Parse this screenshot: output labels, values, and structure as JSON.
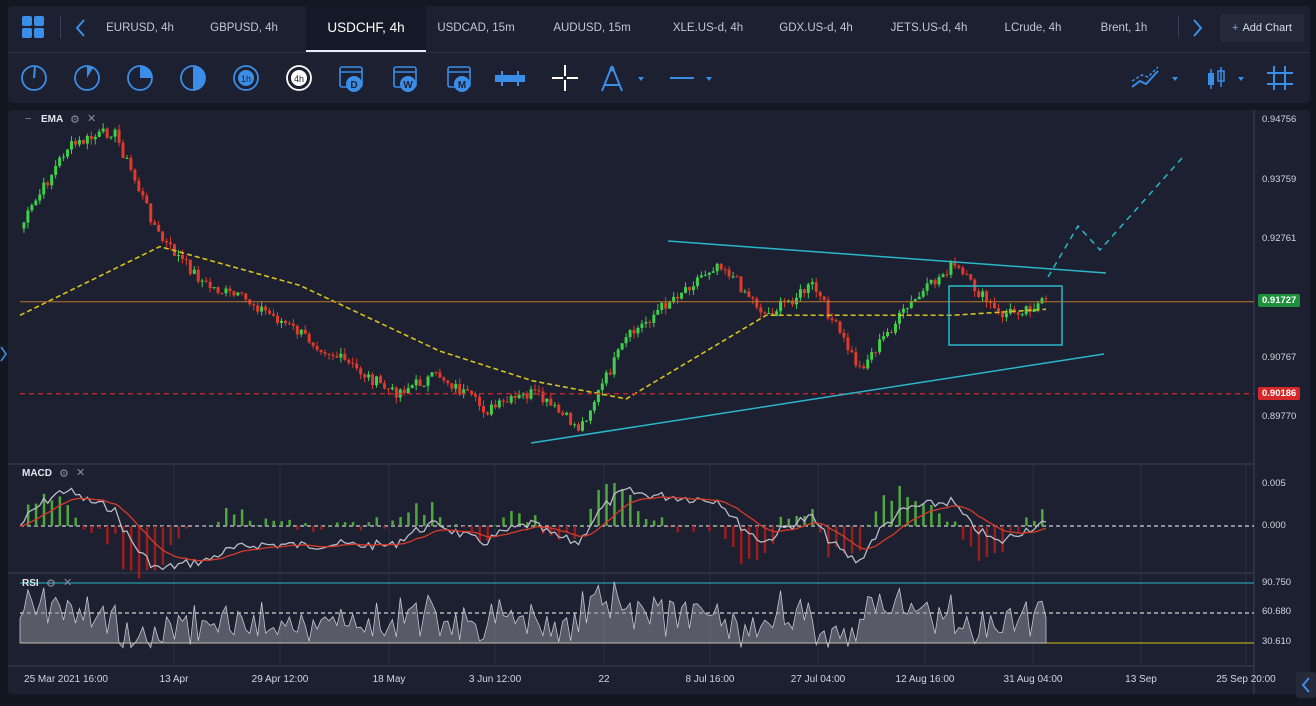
{
  "tabs": [
    {
      "label": "EURUSD, 4h"
    },
    {
      "label": "GBPUSD, 4h"
    },
    {
      "label": "USDCHF, 4h"
    },
    {
      "label": "USDCAD, 15m"
    },
    {
      "label": "AUDUSD, 15m"
    },
    {
      "label": "XLE.US-d, 4h"
    },
    {
      "label": "GDX.US-d, 4h"
    },
    {
      "label": "JETS.US-d, 4h"
    },
    {
      "label": "LCrude, 4h"
    },
    {
      "label": "Brent, 1h"
    }
  ],
  "active_tab": "USDCHF, 4h",
  "add_chart_label": "Add Chart",
  "toolbar": {
    "timeframe_icons": [
      "clock-1m-icon",
      "clock-5m-icon",
      "clock-15m-icon",
      "clock-30m-icon",
      "clock-1h-icon",
      "clock-4h-icon"
    ],
    "clock_1h_label": "1h",
    "clock_4h_label": "4h",
    "calendar_labels": [
      "D",
      "W",
      "M"
    ],
    "drawing_icons": [
      "bar-spacing-icon",
      "crosshair-icon",
      "draw-tool-icon",
      "line-style-icon"
    ],
    "right_icons": [
      "indicators-icon",
      "candle-type-icon",
      "grid-icon"
    ]
  },
  "panels": {
    "main": {
      "label": "EMA"
    },
    "macd": {
      "label": "MACD"
    },
    "rsi": {
      "label": "RSI"
    }
  },
  "price_axis": {
    "ticks": [
      "0.94756",
      "0.93759",
      "0.92761",
      "0.91727",
      "0.90767",
      "0.90186",
      "0.89770"
    ],
    "current_price": "0.91727",
    "level_price": "0.90186"
  },
  "macd_axis": {
    "ticks": [
      "0.005",
      "0.000"
    ]
  },
  "rsi_axis": {
    "ticks": [
      "90.750",
      "60.680",
      "30.610"
    ]
  },
  "time_axis": {
    "labels": [
      "25 Mar 2021 16:00",
      "13 Apr",
      "29 Apr 12:00",
      "18 May",
      "3 Jun 12:00",
      "22",
      "8 Jul 16:00",
      "27 Jul 04:00",
      "12 Aug 16:00",
      "31 Aug 04:00",
      "13 Sep",
      "25 Sep 20:00"
    ]
  },
  "colors": {
    "bg": "#1c2030",
    "bull": "#3fcf4a",
    "bear": "#e23a2a",
    "ema": "#d8c21d",
    "trendline": "#2ab7c9",
    "level_orange": "#c0762a",
    "level_red": "#d62828",
    "price_tag_green": "#1f8f3d",
    "price_tag_red": "#d62828"
  },
  "chart_data": {
    "type": "candlestick",
    "symbol": "USDCHF",
    "timeframe": "4h",
    "close_path": [
      {
        "t": "25 Mar 2021 16:00",
        "v": 0.9295
      },
      {
        "t": "30 Mar",
        "v": 0.943
      },
      {
        "t": "2 Apr",
        "v": 0.946
      },
      {
        "t": "8 Apr",
        "v": 0.928
      },
      {
        "t": "13 Apr",
        "v": 0.92
      },
      {
        "t": "20 Apr",
        "v": 0.917
      },
      {
        "t": "29 Apr 12:00",
        "v": 0.912
      },
      {
        "t": "6 May",
        "v": 0.907
      },
      {
        "t": "12 May",
        "v": 0.902
      },
      {
        "t": "18 May",
        "v": 0.905
      },
      {
        "t": "25 May",
        "v": 0.899
      },
      {
        "t": "3 Jun 12:00",
        "v": 0.902
      },
      {
        "t": "11 Jun",
        "v": 0.896
      },
      {
        "t": "18 Jun",
        "v": 0.911
      },
      {
        "t": "22 Jun",
        "v": 0.918
      },
      {
        "t": "1 Jul",
        "v": 0.924
      },
      {
        "t": "8 Jul 16:00",
        "v": 0.915
      },
      {
        "t": "16 Jul",
        "v": 0.92
      },
      {
        "t": "27 Jul 04:00",
        "v": 0.906
      },
      {
        "t": "4 Aug",
        "v": 0.916
      },
      {
        "t": "12 Aug 16:00",
        "v": 0.9235
      },
      {
        "t": "19 Aug",
        "v": 0.915
      },
      {
        "t": "31 Aug 04:00",
        "v": 0.9172
      }
    ],
    "ema": [
      {
        "t": "25 Mar 2021 16:00",
        "v": 0.915
      },
      {
        "t": "8 Apr",
        "v": 0.9265
      },
      {
        "t": "29 Apr 12:00",
        "v": 0.92
      },
      {
        "t": "18 May",
        "v": 0.909
      },
      {
        "t": "3 Jun 12:00",
        "v": 0.904
      },
      {
        "t": "18 Jun",
        "v": 0.901
      },
      {
        "t": "8 Jul 16:00",
        "v": 0.915
      },
      {
        "t": "27 Jul 04:00",
        "v": 0.915
      },
      {
        "t": "12 Aug 16:00",
        "v": 0.915
      },
      {
        "t": "31 Aug 04:00",
        "v": 0.916
      }
    ],
    "horizontal_levels": [
      0.91727,
      0.90186
    ],
    "annotations": [
      "upper descending trendline",
      "lower ascending trendline",
      "consolidation rectangle",
      "projected path (dashed)"
    ],
    "macd_ylim": [
      -0.003,
      0.005
    ],
    "rsi_levels": [
      30.61,
      60.68,
      90.75
    ]
  }
}
